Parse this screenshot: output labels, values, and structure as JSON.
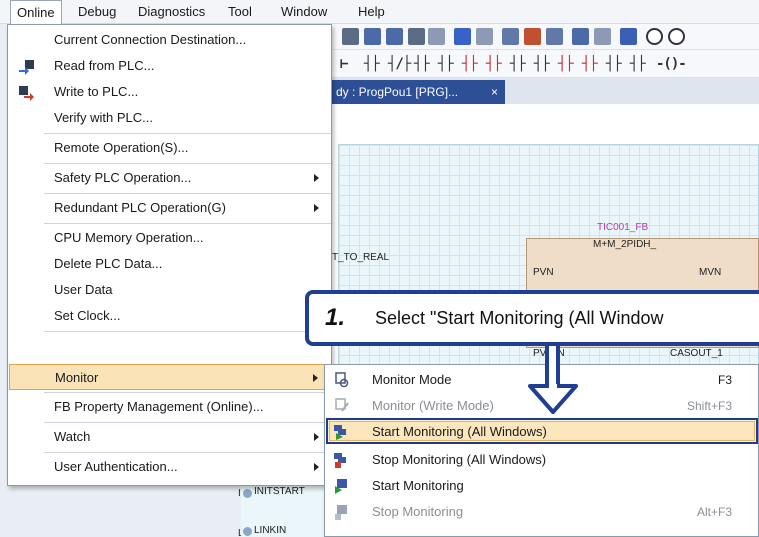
{
  "menubar": {
    "items": [
      "Online",
      "Debug",
      "Diagnostics",
      "Tool",
      "Window",
      "Help"
    ]
  },
  "tab": {
    "label": "dy : ProgPou1 [PRG]...",
    "close": "×"
  },
  "canvas": {
    "fb_instance": "TIC001_FB",
    "fb_type": "M+M_2PIDH_",
    "fb_pin_pvn": "PVN",
    "fb_pin_mvn": "MVN",
    "left_label": "T_TO_REAL",
    "pin_pvmin": "PVMIN",
    "pin_casout": "CASOUT_1",
    "var_initstart": "INITSTART",
    "var_linkin": "LINKIN"
  },
  "online_menu": {
    "items": [
      {
        "label": "Current Connection Destination...",
        "icon": null,
        "submenu": false
      },
      {
        "label": "Read from PLC...",
        "icon": "read-from-plc-icon",
        "submenu": false
      },
      {
        "label": "Write to PLC...",
        "icon": "write-to-plc-icon",
        "submenu": false
      },
      {
        "label": "Verify with PLC...",
        "icon": null,
        "submenu": false
      },
      {
        "label": "Remote Operation(S)...",
        "icon": null,
        "submenu": false
      },
      {
        "label": "Safety PLC Operation...",
        "icon": null,
        "submenu": true
      },
      {
        "label": "Redundant PLC Operation(G)",
        "icon": null,
        "submenu": true
      },
      {
        "label": "CPU Memory Operation...",
        "icon": null,
        "submenu": false
      },
      {
        "label": "Delete PLC Data...",
        "icon": null,
        "submenu": false
      },
      {
        "label": "User Data",
        "icon": null,
        "submenu": false
      },
      {
        "label": "Set Clock...",
        "icon": null,
        "submenu": false
      },
      {
        "label": "Monitor",
        "icon": null,
        "submenu": true
      },
      {
        "label": "FB Property Management (Online)...",
        "icon": null,
        "submenu": false
      },
      {
        "label": "Watch",
        "icon": null,
        "submenu": true
      },
      {
        "label": "User Authentication...",
        "icon": null,
        "submenu": true
      }
    ]
  },
  "monitor_submenu": {
    "items": [
      {
        "label": "Monitor Mode",
        "shortcut": "F3",
        "disabled": false
      },
      {
        "label": "Monitor (Write Mode)",
        "shortcut": "Shift+F3",
        "disabled": true
      },
      {
        "label": "Start Monitoring (All Windows)",
        "shortcut": "",
        "disabled": false
      },
      {
        "label": "Stop Monitoring (All Windows)",
        "shortcut": "",
        "disabled": false
      },
      {
        "label": "Start Monitoring",
        "shortcut": "",
        "disabled": false
      },
      {
        "label": "Stop Monitoring",
        "shortcut": "Alt+F3",
        "disabled": true
      }
    ]
  },
  "callout": {
    "step": "1.",
    "text": "Select \"Start Monitoring (All Window"
  },
  "colors": {
    "accent": "#1f3f95",
    "highlight": "#fbe3b8",
    "tab_active": "#2c4f96"
  }
}
